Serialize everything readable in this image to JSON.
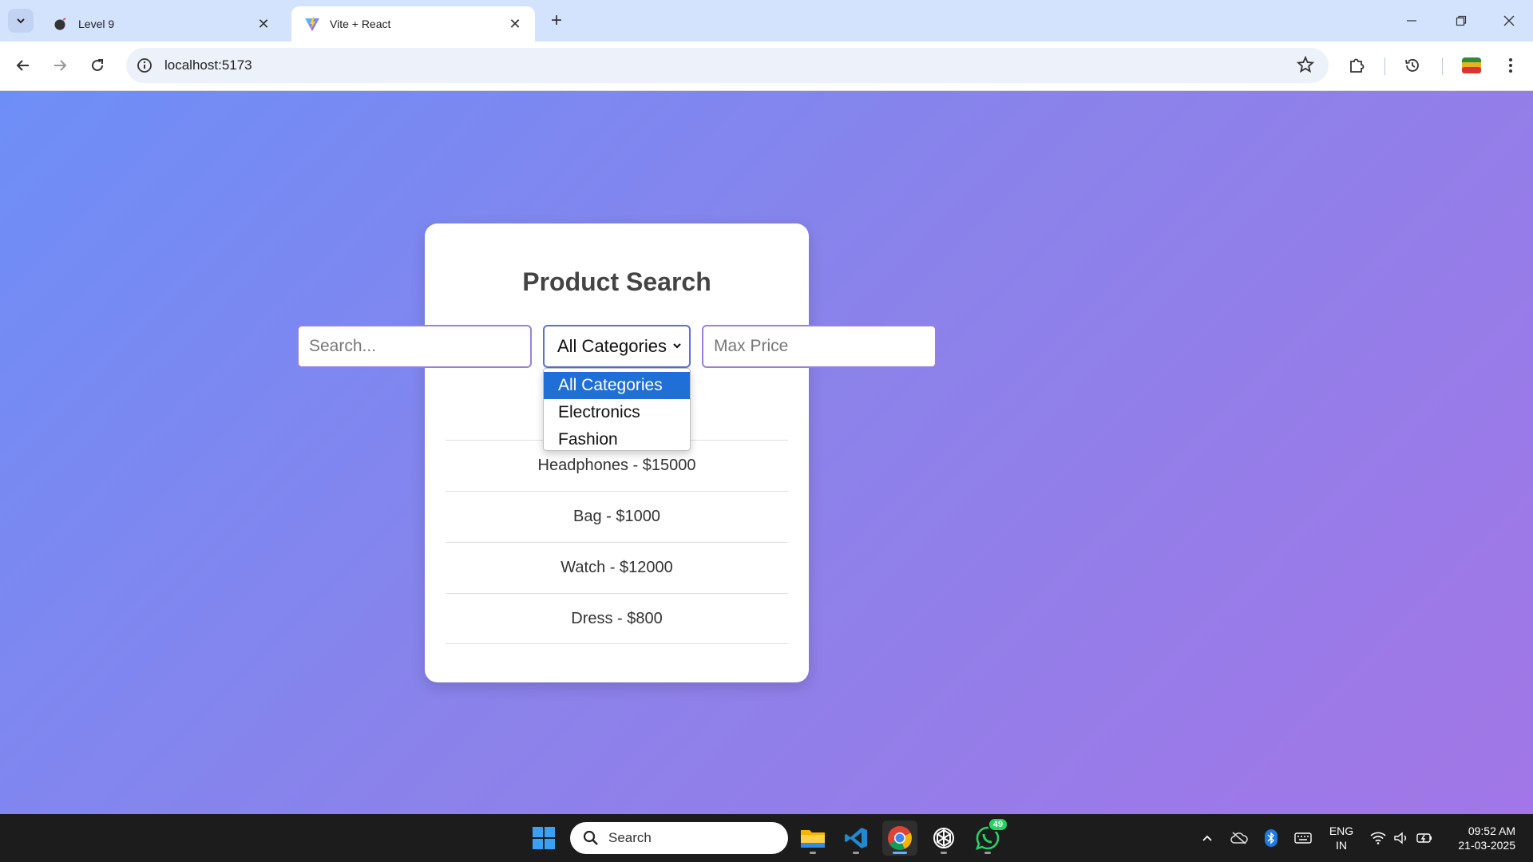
{
  "browser": {
    "tabs": [
      {
        "title": "Level 9",
        "icon": "bomb-icon",
        "active": false
      },
      {
        "title": "Vite + React",
        "icon": "vite-icon",
        "active": true
      }
    ],
    "url": "localhost:5173"
  },
  "page": {
    "title": "Product Search",
    "search_placeholder": "Search...",
    "category_selected": "All Categories",
    "price_placeholder": "Max Price",
    "category_options": [
      "All Categories",
      "Electronics",
      "Fashion"
    ],
    "products": [
      {
        "label": "Headphones - $15000"
      },
      {
        "label": "Bag - $1000"
      },
      {
        "label": "Watch - $12000"
      },
      {
        "label": "Dress - $800"
      }
    ]
  },
  "taskbar": {
    "search_label": "Search",
    "whatsapp_badge": "49",
    "language": "ENG",
    "region": "IN",
    "time": "09:52 AM",
    "date": "21-03-2025"
  },
  "colors": {
    "gradient_start": "#6e8ef7",
    "gradient_end": "#a276e6",
    "selected_option": "#1f6fd6"
  }
}
